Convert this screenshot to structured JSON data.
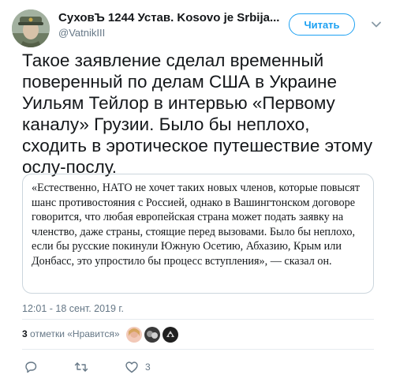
{
  "user": {
    "display_name": "СуховЪ 1244 Устав. Kosovo je Srbija...",
    "handle": "@VatnikIII",
    "avatar_icon": "user-avatar-icon"
  },
  "follow_button": {
    "label": "Читать",
    "color": "#1da1f2"
  },
  "menu_icon": "chevron-down-icon",
  "tweet": {
    "text": "Такое заявление сделал временный поверенный по делам США в Украине Уильям Тейлор в интервью «Первому каналу» Грузии. Было бы неплохо, сходить в эротическое путешествие этому ослу-послу."
  },
  "quote": {
    "text": "«Естественно, НАТО не хочет таких новых членов, которые повысят шанс противостояния с Россией, однако в Вашингтонском договоре говорится, что любая европейская страна может подать заявку на членство, даже страны, стоящие перед вызовами. Было бы неплохо, если бы русские покинули Южную Осетию, Абхазию, Крым или Донбасс, это упростило бы процесс вступления», — сказал он."
  },
  "timestamp": "12:01 - 18 сент. 2019 г.",
  "likes": {
    "count": "3",
    "label": "отметки «Нравится»",
    "avatars": [
      "liker-avatar-1",
      "liker-avatar-2",
      "liker-avatar-3"
    ]
  },
  "actions": {
    "reply_icon": "reply-icon",
    "retweet_icon": "retweet-icon",
    "like_icon": "heart-icon",
    "like_count": "3"
  },
  "colors": {
    "text": "#14171a",
    "secondary": "#657786",
    "border": "#ccd6dd",
    "accent": "#1da1f2"
  }
}
